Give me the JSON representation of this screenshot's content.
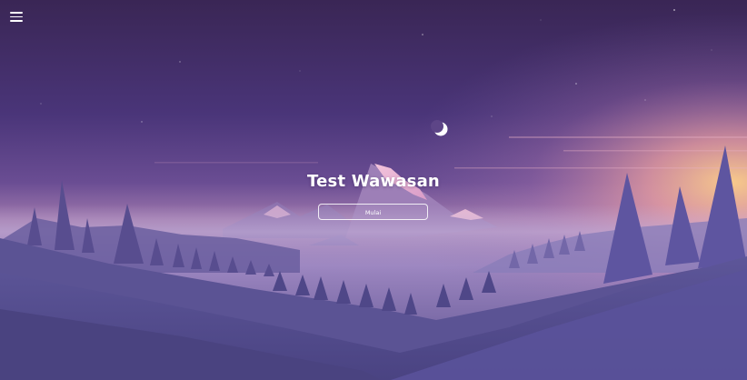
{
  "header": {
    "menu_icon": "hamburger-menu-icon"
  },
  "hero": {
    "title": "Test Wawasan",
    "start_button_label": "Mulai"
  },
  "colors": {
    "sky_top": "#3d2858",
    "sky_mid": "#56418a",
    "horizon_glow": "#e8a0a8",
    "horizon_warm": "#f4c38c",
    "fog": "#b9a7d6",
    "foreground": "#4b4580",
    "text": "#ffffff"
  }
}
